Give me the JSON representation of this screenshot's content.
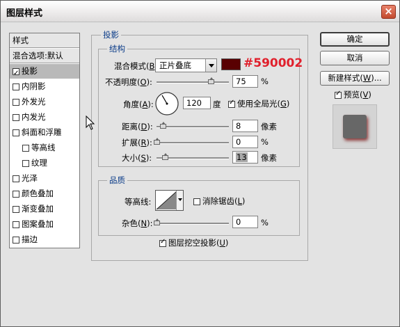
{
  "window": {
    "title": "图层样式",
    "close_glyph": "×"
  },
  "styles_list": {
    "header": "样式",
    "blend_defaults": "混合选项:默认",
    "items": [
      {
        "label": "投影",
        "checked": true,
        "selected": true,
        "indent": false
      },
      {
        "label": "内阴影",
        "checked": false,
        "selected": false,
        "indent": false
      },
      {
        "label": "外发光",
        "checked": false,
        "selected": false,
        "indent": false
      },
      {
        "label": "内发光",
        "checked": false,
        "selected": false,
        "indent": false
      },
      {
        "label": "斜面和浮雕",
        "checked": false,
        "selected": false,
        "indent": false
      },
      {
        "label": "等高线",
        "checked": false,
        "selected": false,
        "indent": true
      },
      {
        "label": "纹理",
        "checked": false,
        "selected": false,
        "indent": true
      },
      {
        "label": "光泽",
        "checked": false,
        "selected": false,
        "indent": false
      },
      {
        "label": "颜色叠加",
        "checked": false,
        "selected": false,
        "indent": false
      },
      {
        "label": "渐变叠加",
        "checked": false,
        "selected": false,
        "indent": false
      },
      {
        "label": "图案叠加",
        "checked": false,
        "selected": false,
        "indent": false
      },
      {
        "label": "描边",
        "checked": false,
        "selected": false,
        "indent": false
      }
    ]
  },
  "drop_shadow": {
    "section_title": "投影",
    "structure_title": "结构",
    "blend_mode_label": "混合模式",
    "blend_mode_key": "B",
    "blend_mode_value": "正片叠底",
    "shadow_color": "#590002",
    "color_hex_label": "#590002",
    "opacity_label": "不透明度",
    "opacity_key": "O",
    "opacity_value": "75",
    "opacity_unit": "%",
    "opacity_fraction": 0.75,
    "angle_label": "角度",
    "angle_key": "A",
    "angle_value": "120",
    "angle_unit": "度",
    "use_global_light_label": "使用全局光",
    "use_global_light_key": "G",
    "use_global_light_checked": true,
    "distance_label": "距离",
    "distance_key": "D",
    "distance_value": "8",
    "distance_unit": "像素",
    "spread_label": "扩展",
    "spread_key": "R",
    "spread_value": "0",
    "spread_unit": "%",
    "size_label": "大小",
    "size_key": "S",
    "size_value": "13",
    "size_unit": "像素",
    "quality_title": "品质",
    "contour_label": "等高线",
    "anti_alias_label": "消除锯齿",
    "anti_alias_key": "L",
    "anti_alias_checked": false,
    "noise_label": "杂色",
    "noise_key": "N",
    "noise_value": "0",
    "noise_unit": "%",
    "knockout_label": "图层挖空投影",
    "knockout_key": "U",
    "knockout_checked": true
  },
  "buttons": {
    "ok": "确定",
    "cancel": "取消",
    "new_style": "新建样式",
    "new_style_key": "W",
    "new_style_suffix": "...",
    "preview_label": "预览",
    "preview_key": "V",
    "preview_checked": true
  },
  "colors": {
    "accent_blue": "#0a3b88",
    "color_label_red": "#e0202c",
    "panel_bg": "#e3e3e3"
  }
}
